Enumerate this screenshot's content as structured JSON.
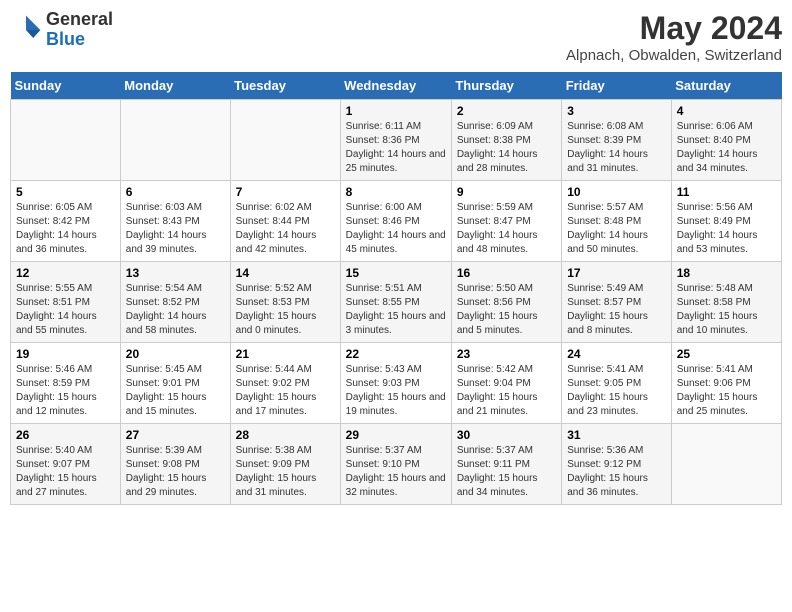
{
  "logo": {
    "general": "General",
    "blue": "Blue"
  },
  "header": {
    "title": "May 2024",
    "subtitle": "Alpnach, Obwalden, Switzerland"
  },
  "weekdays": [
    "Sunday",
    "Monday",
    "Tuesday",
    "Wednesday",
    "Thursday",
    "Friday",
    "Saturday"
  ],
  "weeks": [
    [
      {
        "day": "",
        "sunrise": "",
        "sunset": "",
        "daylight": ""
      },
      {
        "day": "",
        "sunrise": "",
        "sunset": "",
        "daylight": ""
      },
      {
        "day": "",
        "sunrise": "",
        "sunset": "",
        "daylight": ""
      },
      {
        "day": "1",
        "sunrise": "Sunrise: 6:11 AM",
        "sunset": "Sunset: 8:36 PM",
        "daylight": "Daylight: 14 hours and 25 minutes."
      },
      {
        "day": "2",
        "sunrise": "Sunrise: 6:09 AM",
        "sunset": "Sunset: 8:38 PM",
        "daylight": "Daylight: 14 hours and 28 minutes."
      },
      {
        "day": "3",
        "sunrise": "Sunrise: 6:08 AM",
        "sunset": "Sunset: 8:39 PM",
        "daylight": "Daylight: 14 hours and 31 minutes."
      },
      {
        "day": "4",
        "sunrise": "Sunrise: 6:06 AM",
        "sunset": "Sunset: 8:40 PM",
        "daylight": "Daylight: 14 hours and 34 minutes."
      }
    ],
    [
      {
        "day": "5",
        "sunrise": "Sunrise: 6:05 AM",
        "sunset": "Sunset: 8:42 PM",
        "daylight": "Daylight: 14 hours and 36 minutes."
      },
      {
        "day": "6",
        "sunrise": "Sunrise: 6:03 AM",
        "sunset": "Sunset: 8:43 PM",
        "daylight": "Daylight: 14 hours and 39 minutes."
      },
      {
        "day": "7",
        "sunrise": "Sunrise: 6:02 AM",
        "sunset": "Sunset: 8:44 PM",
        "daylight": "Daylight: 14 hours and 42 minutes."
      },
      {
        "day": "8",
        "sunrise": "Sunrise: 6:00 AM",
        "sunset": "Sunset: 8:46 PM",
        "daylight": "Daylight: 14 hours and 45 minutes."
      },
      {
        "day": "9",
        "sunrise": "Sunrise: 5:59 AM",
        "sunset": "Sunset: 8:47 PM",
        "daylight": "Daylight: 14 hours and 48 minutes."
      },
      {
        "day": "10",
        "sunrise": "Sunrise: 5:57 AM",
        "sunset": "Sunset: 8:48 PM",
        "daylight": "Daylight: 14 hours and 50 minutes."
      },
      {
        "day": "11",
        "sunrise": "Sunrise: 5:56 AM",
        "sunset": "Sunset: 8:49 PM",
        "daylight": "Daylight: 14 hours and 53 minutes."
      }
    ],
    [
      {
        "day": "12",
        "sunrise": "Sunrise: 5:55 AM",
        "sunset": "Sunset: 8:51 PM",
        "daylight": "Daylight: 14 hours and 55 minutes."
      },
      {
        "day": "13",
        "sunrise": "Sunrise: 5:54 AM",
        "sunset": "Sunset: 8:52 PM",
        "daylight": "Daylight: 14 hours and 58 minutes."
      },
      {
        "day": "14",
        "sunrise": "Sunrise: 5:52 AM",
        "sunset": "Sunset: 8:53 PM",
        "daylight": "Daylight: 15 hours and 0 minutes."
      },
      {
        "day": "15",
        "sunrise": "Sunrise: 5:51 AM",
        "sunset": "Sunset: 8:55 PM",
        "daylight": "Daylight: 15 hours and 3 minutes."
      },
      {
        "day": "16",
        "sunrise": "Sunrise: 5:50 AM",
        "sunset": "Sunset: 8:56 PM",
        "daylight": "Daylight: 15 hours and 5 minutes."
      },
      {
        "day": "17",
        "sunrise": "Sunrise: 5:49 AM",
        "sunset": "Sunset: 8:57 PM",
        "daylight": "Daylight: 15 hours and 8 minutes."
      },
      {
        "day": "18",
        "sunrise": "Sunrise: 5:48 AM",
        "sunset": "Sunset: 8:58 PM",
        "daylight": "Daylight: 15 hours and 10 minutes."
      }
    ],
    [
      {
        "day": "19",
        "sunrise": "Sunrise: 5:46 AM",
        "sunset": "Sunset: 8:59 PM",
        "daylight": "Daylight: 15 hours and 12 minutes."
      },
      {
        "day": "20",
        "sunrise": "Sunrise: 5:45 AM",
        "sunset": "Sunset: 9:01 PM",
        "daylight": "Daylight: 15 hours and 15 minutes."
      },
      {
        "day": "21",
        "sunrise": "Sunrise: 5:44 AM",
        "sunset": "Sunset: 9:02 PM",
        "daylight": "Daylight: 15 hours and 17 minutes."
      },
      {
        "day": "22",
        "sunrise": "Sunrise: 5:43 AM",
        "sunset": "Sunset: 9:03 PM",
        "daylight": "Daylight: 15 hours and 19 minutes."
      },
      {
        "day": "23",
        "sunrise": "Sunrise: 5:42 AM",
        "sunset": "Sunset: 9:04 PM",
        "daylight": "Daylight: 15 hours and 21 minutes."
      },
      {
        "day": "24",
        "sunrise": "Sunrise: 5:41 AM",
        "sunset": "Sunset: 9:05 PM",
        "daylight": "Daylight: 15 hours and 23 minutes."
      },
      {
        "day": "25",
        "sunrise": "Sunrise: 5:41 AM",
        "sunset": "Sunset: 9:06 PM",
        "daylight": "Daylight: 15 hours and 25 minutes."
      }
    ],
    [
      {
        "day": "26",
        "sunrise": "Sunrise: 5:40 AM",
        "sunset": "Sunset: 9:07 PM",
        "daylight": "Daylight: 15 hours and 27 minutes."
      },
      {
        "day": "27",
        "sunrise": "Sunrise: 5:39 AM",
        "sunset": "Sunset: 9:08 PM",
        "daylight": "Daylight: 15 hours and 29 minutes."
      },
      {
        "day": "28",
        "sunrise": "Sunrise: 5:38 AM",
        "sunset": "Sunset: 9:09 PM",
        "daylight": "Daylight: 15 hours and 31 minutes."
      },
      {
        "day": "29",
        "sunrise": "Sunrise: 5:37 AM",
        "sunset": "Sunset: 9:10 PM",
        "daylight": "Daylight: 15 hours and 32 minutes."
      },
      {
        "day": "30",
        "sunrise": "Sunrise: 5:37 AM",
        "sunset": "Sunset: 9:11 PM",
        "daylight": "Daylight: 15 hours and 34 minutes."
      },
      {
        "day": "31",
        "sunrise": "Sunrise: 5:36 AM",
        "sunset": "Sunset: 9:12 PM",
        "daylight": "Daylight: 15 hours and 36 minutes."
      },
      {
        "day": "",
        "sunrise": "",
        "sunset": "",
        "daylight": ""
      }
    ]
  ]
}
